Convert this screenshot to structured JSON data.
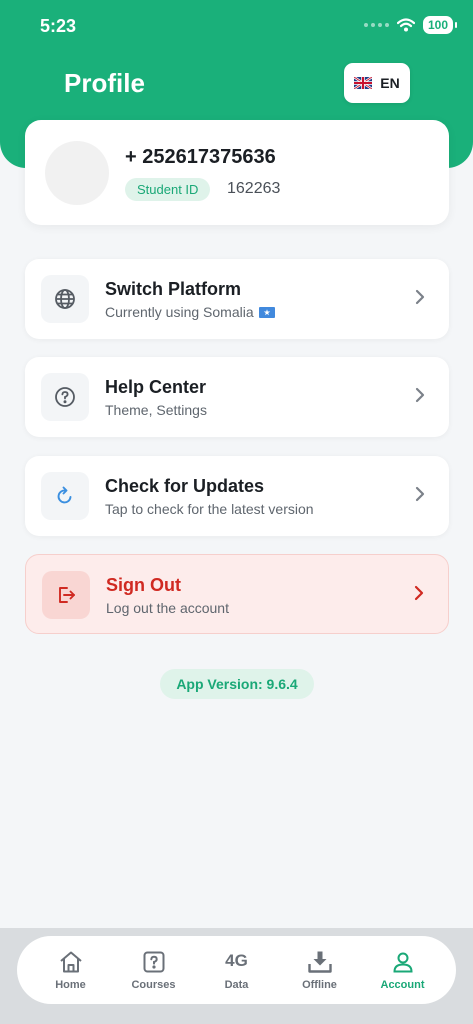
{
  "status_bar": {
    "time": "5:23",
    "battery": "100"
  },
  "header": {
    "title": "Profile",
    "language": {
      "code": "EN",
      "flag_icon": "uk-flag-icon"
    }
  },
  "profile": {
    "phone": "+ 252617375636",
    "student_id_label": "Student ID",
    "student_id": "162263"
  },
  "menu": [
    {
      "title": "Switch Platform",
      "subtitle": "Currently using Somalia",
      "subtitle_flag": "somalia-flag-icon",
      "icon": "globe-icon"
    },
    {
      "title": "Help Center",
      "subtitle": "Theme, Settings",
      "icon": "question-circle-icon"
    },
    {
      "title": "Check for Updates",
      "subtitle": "Tap to check for the latest version",
      "icon": "refresh-icon"
    },
    {
      "title": "Sign Out",
      "subtitle": "Log out the account",
      "icon": "logout-icon",
      "danger": true
    }
  ],
  "app_version": "App Version: 9.6.4",
  "tabs": [
    {
      "label": "Home",
      "icon": "home-icon"
    },
    {
      "label": "Courses",
      "icon": "question-box-icon"
    },
    {
      "label": "Data",
      "icon": "4g-icon",
      "glyph": "4G"
    },
    {
      "label": "Offline",
      "icon": "download-icon"
    },
    {
      "label": "Account",
      "icon": "user-icon",
      "active": true
    }
  ],
  "colors": {
    "primary": "#1ab07a",
    "danger": "#d02a22",
    "danger_bg": "#fdeceb",
    "background": "#f4f6f8"
  }
}
